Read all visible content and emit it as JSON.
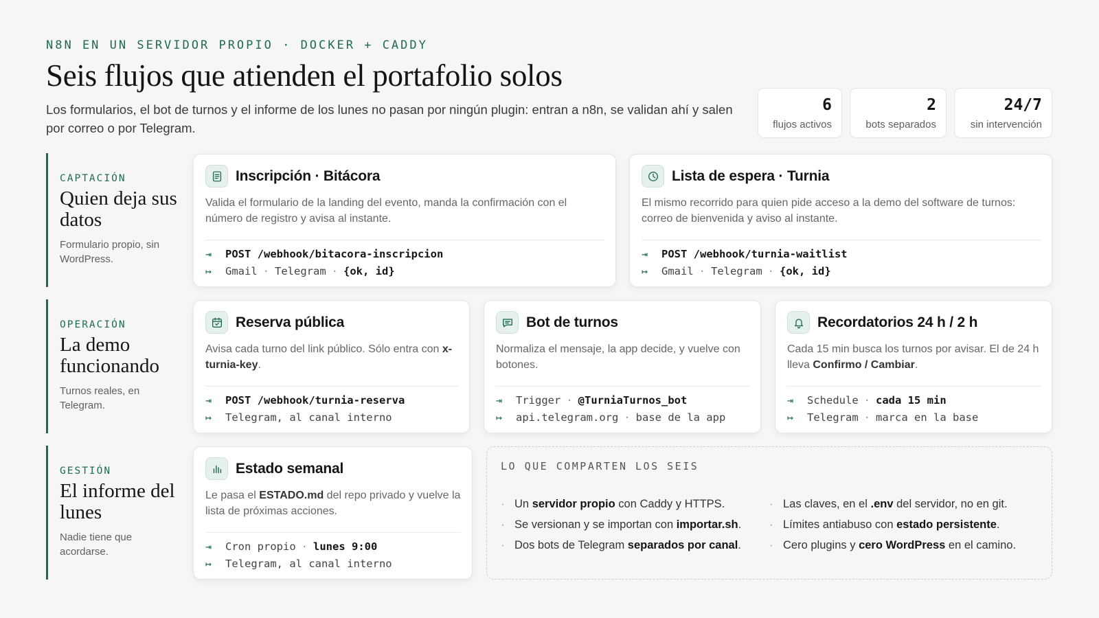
{
  "header": {
    "eyebrow": "N8N EN UN SERVIDOR PROPIO · DOCKER + CADDY",
    "title": "Seis flujos que atienden el portafolio solos",
    "subtitle": "Los formularios, el bot de turnos y el informe de los lunes no pasan por ningún plugin: entran a n8n, se validan ahí y salen por correo o por Telegram."
  },
  "stats": [
    {
      "value": "6",
      "label": "flujos activos"
    },
    {
      "value": "2",
      "label": "bots separados"
    },
    {
      "value": "24/7",
      "label": "sin intervención"
    }
  ],
  "sections": {
    "captacion": {
      "eyebrow": "CAPTACIÓN",
      "title": "Quien deja sus datos",
      "desc": "Formulario propio, sin WordPress."
    },
    "operacion": {
      "eyebrow": "OPERACIÓN",
      "title": "La demo funcionando",
      "desc": "Turnos reales, en Telegram."
    },
    "gestion": {
      "eyebrow": "GESTIÓN",
      "title": "El informe del lunes",
      "desc": "Nadie tiene que acordarse."
    }
  },
  "cards": {
    "inscripcion": {
      "icon": "document-icon",
      "title": "Inscripción · Bitácora",
      "desc": "Valida el formulario de la landing del evento, manda la confirmación con el número de registro y avisa al instante.",
      "in_a": "POST /webhook/bitacora-inscripcion",
      "out_a": "Gmail",
      "out_b": "Telegram",
      "out_c": "{ok, id}"
    },
    "espera": {
      "icon": "clock-icon",
      "title": "Lista de espera · Turnia",
      "desc": "El mismo recorrido para quien pide acceso a la demo del software de turnos: correo de bienvenida y aviso al instante.",
      "in_a": "POST /webhook/turnia-waitlist",
      "out_a": "Gmail",
      "out_b": "Telegram",
      "out_c": "{ok, id}"
    },
    "reserva": {
      "icon": "calendar-icon",
      "title": "Reserva pública",
      "desc_a": "Avisa cada turno del link público. Sólo entra con ",
      "desc_b": "x-turnia-key",
      "desc_c": ".",
      "in_a": "POST /webhook/turnia-reserva",
      "out_a": "Telegram, al canal interno"
    },
    "bot": {
      "icon": "chat-icon",
      "title": "Bot de turnos",
      "desc": "Normaliza el mensaje, la app decide, y vuelve con botones.",
      "in_a": "Trigger",
      "in_b": "@TurniaTurnos_bot",
      "out_a": "api.telegram.org",
      "out_b": "base de la app"
    },
    "recordatorios": {
      "icon": "bell-icon",
      "title": "Recordatorios 24 h / 2 h",
      "desc_a": "Cada 15 min busca los turnos por avisar. El de 24 h lleva ",
      "desc_b": "Confirmo / Cambiar",
      "desc_c": ".",
      "in_a": "Schedule",
      "in_b": "cada 15 min",
      "out_a": "Telegram",
      "out_b": "marca en la base"
    },
    "semanal": {
      "icon": "bar-chart-icon",
      "title": "Estado semanal",
      "desc_a": "Le pasa el ",
      "desc_b": "ESTADO.md",
      "desc_c": " del repo privado y vuelve la lista de próximas acciones.",
      "in_a": "Cron propio",
      "in_b": "lunes 9:00",
      "out_a": "Telegram, al canal interno"
    }
  },
  "shared": {
    "title": "LO QUE COMPARTEN LOS SEIS",
    "left": [
      {
        "a": "Un ",
        "b": "servidor propio",
        "c": " con Caddy y HTTPS."
      },
      {
        "a": "Se versionan y se importan con ",
        "b": "importar.sh",
        "c": "."
      },
      {
        "a": "Dos bots de Telegram ",
        "b": "separados por canal",
        "c": "."
      }
    ],
    "right": [
      {
        "a": "Las claves, en el ",
        "b": ".env",
        "c": " del servidor, no en git."
      },
      {
        "a": "Límites antiabuso con ",
        "b": "estado persistente",
        "c": "."
      },
      {
        "a": "Cero plugins y ",
        "b": "cero WordPress",
        "c": " en el camino."
      }
    ]
  },
  "colors": {
    "accent": "#1e6b52",
    "background": "#f6f6f5",
    "card": "#ffffff"
  }
}
